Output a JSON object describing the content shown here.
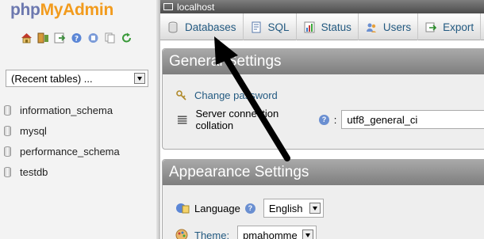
{
  "logo": {
    "part1": "php",
    "part2": "MyAdmin"
  },
  "nav_icons": [
    "home-icon",
    "exit-icon",
    "query-window-icon",
    "help-icon",
    "docs-icon",
    "copy-icon",
    "reload-icon"
  ],
  "recent_tables": {
    "value": "(Recent tables) ..."
  },
  "databases": [
    "information_schema",
    "mysql",
    "performance_schema",
    "testdb"
  ],
  "server_bar": {
    "label": "localhost"
  },
  "tabs": [
    {
      "label": "Databases",
      "icon": "database-icon"
    },
    {
      "label": "SQL",
      "icon": "sql-icon"
    },
    {
      "label": "Status",
      "icon": "status-icon"
    },
    {
      "label": "Users",
      "icon": "users-icon"
    },
    {
      "label": "Export",
      "icon": "export-icon"
    }
  ],
  "general": {
    "title": "General Settings",
    "change_password": "Change password",
    "collation_label": "Server connection collation",
    "collation_value": "utf8_general_ci"
  },
  "appearance": {
    "title": "Appearance Settings",
    "language_label": "Language",
    "language_value": "English",
    "theme_label": "Theme:",
    "theme_value": "pmahomme"
  },
  "colors": {
    "accent": "#235a81",
    "logo_blue": "#6c78af",
    "logo_orange": "#f29b1d"
  }
}
